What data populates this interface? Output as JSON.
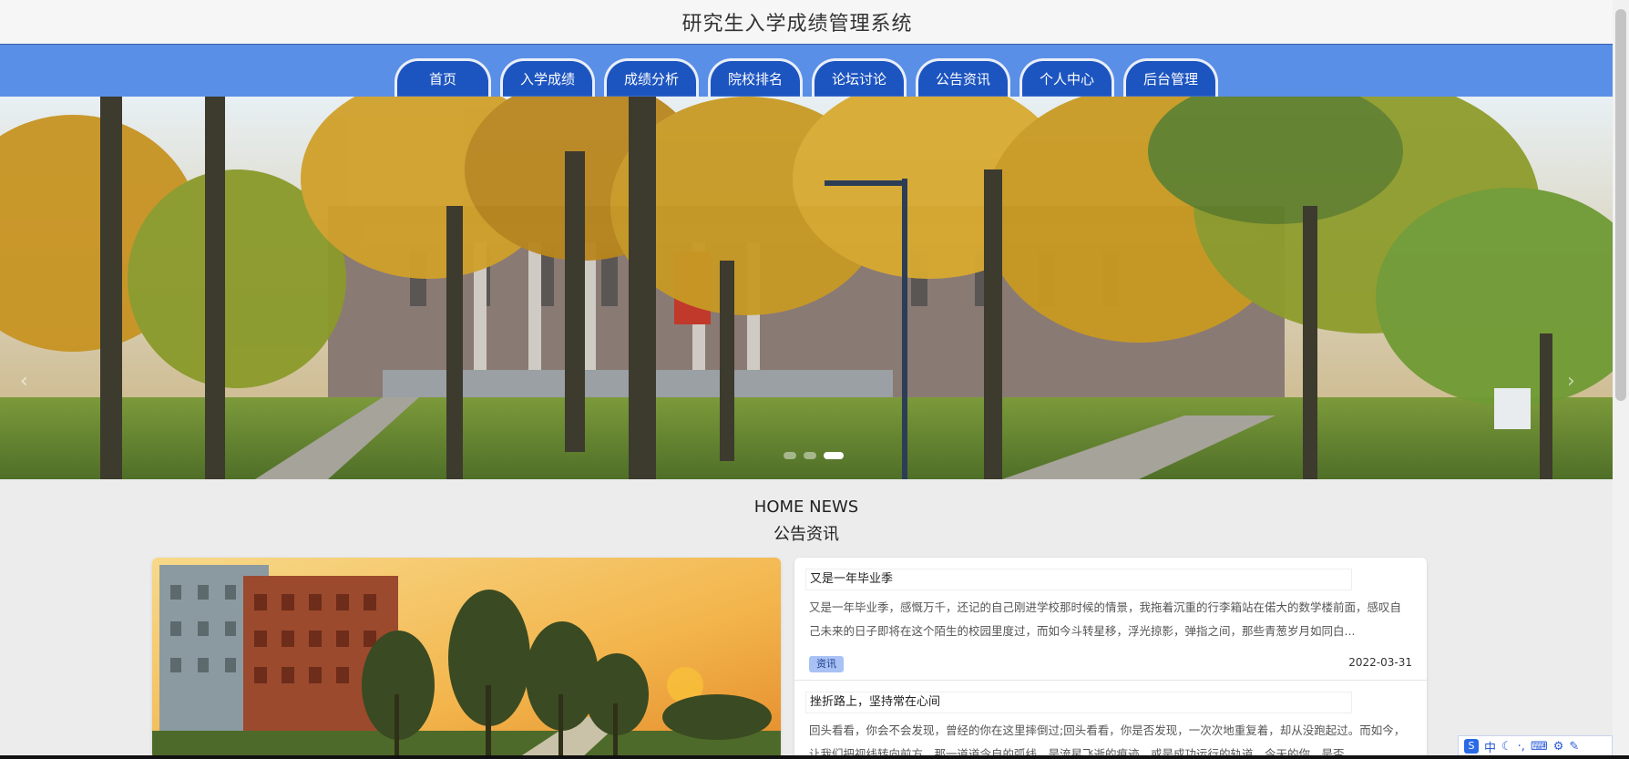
{
  "header": {
    "title": "研究生入学成绩管理系统"
  },
  "nav": {
    "items": [
      {
        "label": "首页"
      },
      {
        "label": "入学成绩"
      },
      {
        "label": "成绩分析"
      },
      {
        "label": "院校排名"
      },
      {
        "label": "论坛讨论"
      },
      {
        "label": "公告资讯"
      },
      {
        "label": "个人中心"
      },
      {
        "label": "后台管理"
      }
    ]
  },
  "banner": {
    "slide_count": 3,
    "active_slide": 2
  },
  "news": {
    "heading_en": "HOME NEWS",
    "heading_cn": "公告资讯",
    "items": [
      {
        "title": "又是一年毕业季",
        "excerpt": "又是一年毕业季，感慨万千，还记的自己刚进学校那时候的情景，我拖着沉重的行李箱站在偌大的数学楼前面，感叹自己未来的日子即将在这个陌生的校园里度过，而如今斗转星移，浮光掠影，弹指之间，那些青葱岁月如同白...",
        "tag": "资讯",
        "date": "2022-03-31"
      },
      {
        "title": "挫折路上，坚持常在心间",
        "excerpt": "回头看看，你会不会发现，曾经的你在这里摔倒过;回头看看，你是否发现，一次次地重复着，却从没跑起过。而如今，让我们把视线转向前方，那一道道令自的弧线，是流星飞逝的痕迹，或是成功运行的轨道，今天的你，是否..."
      }
    ]
  },
  "ime": {
    "lang": "中"
  },
  "colors": {
    "nav_bg": "#5a8fe8",
    "nav_tab": "#1d55c0",
    "tag_bg": "#a9c2f5"
  }
}
